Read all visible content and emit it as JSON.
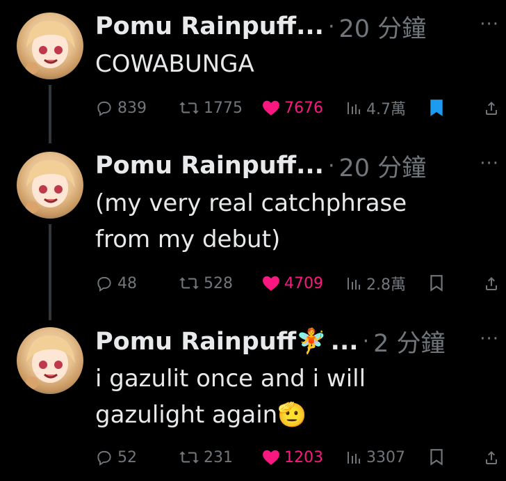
{
  "tweets": [
    {
      "name": "Pomu Rainpuff...",
      "dot": "·",
      "time": "20 分鐘",
      "more": "···",
      "body": "COWABUNGA",
      "replies": "839",
      "retweets": "1775",
      "likes": "7676",
      "views": "4.7萬",
      "bookmarked": true
    },
    {
      "name": "Pomu Rainpuff...",
      "dot": "·",
      "time": "20 分鐘",
      "more": "···",
      "body_line1": "(my very real catchphrase",
      "body_line2": "from my debut)",
      "replies": "48",
      "retweets": "528",
      "likes": "4709",
      "views": "2.8萬",
      "bookmarked": false
    },
    {
      "name": "Pomu Rainpuff",
      "name_emoji": "🧚",
      "name_ellipsis": "...",
      "dot": "·",
      "time": "2 分鐘",
      "more": "···",
      "body_line1": "i gazulit once and i will",
      "body_line2": "gazulight again",
      "body_emoji": "🫡",
      "replies": "52",
      "retweets": "231",
      "likes": "1203",
      "views": "3307",
      "bookmarked": false
    }
  ],
  "colors": {
    "background": "#000000",
    "text": "#e7e9ea",
    "muted": "#71767b",
    "like": "#f91880",
    "bookmark": "#1d9bf0",
    "thread_line": "#333639"
  }
}
